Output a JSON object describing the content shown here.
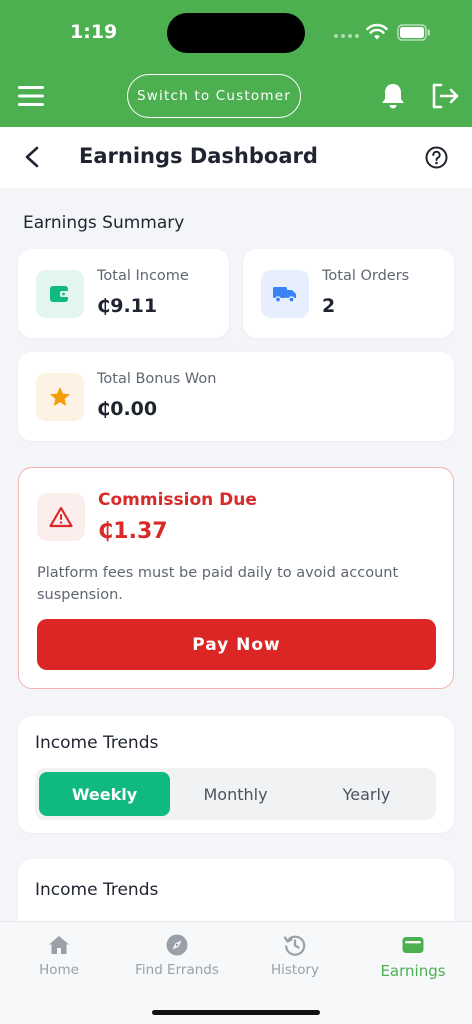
{
  "status_bar": {
    "time": "1:19"
  },
  "header": {
    "switch_label": "Switch to Customer",
    "accent_color": "#4caf50"
  },
  "title_bar": {
    "title": "Earnings Dashboard"
  },
  "summary": {
    "heading": "Earnings Summary",
    "total_income_label": "Total Income",
    "total_income_value": "₵9.11",
    "total_orders_label": "Total Orders",
    "total_orders_value": "2",
    "bonus_label": "Total Bonus Won",
    "bonus_value": "₵0.00"
  },
  "commission": {
    "title": "Commission Due",
    "value": "₵1.37",
    "note": "Platform fees must be paid daily to avoid account suspension.",
    "pay_label": "Pay Now",
    "color": "#dc2626"
  },
  "trends": {
    "title": "Income Trends",
    "tabs": [
      {
        "label": "Weekly",
        "active": true
      },
      {
        "label": "Monthly",
        "active": false
      },
      {
        "label": "Yearly",
        "active": false
      }
    ],
    "chart_title": "Income Trends"
  },
  "tabbar": {
    "items": [
      {
        "label": "Home",
        "icon": "home-icon"
      },
      {
        "label": "Find Errands",
        "icon": "compass-icon"
      },
      {
        "label": "History",
        "icon": "history-icon"
      },
      {
        "label": "Earnings",
        "icon": "wallet-icon",
        "active": true
      }
    ]
  }
}
